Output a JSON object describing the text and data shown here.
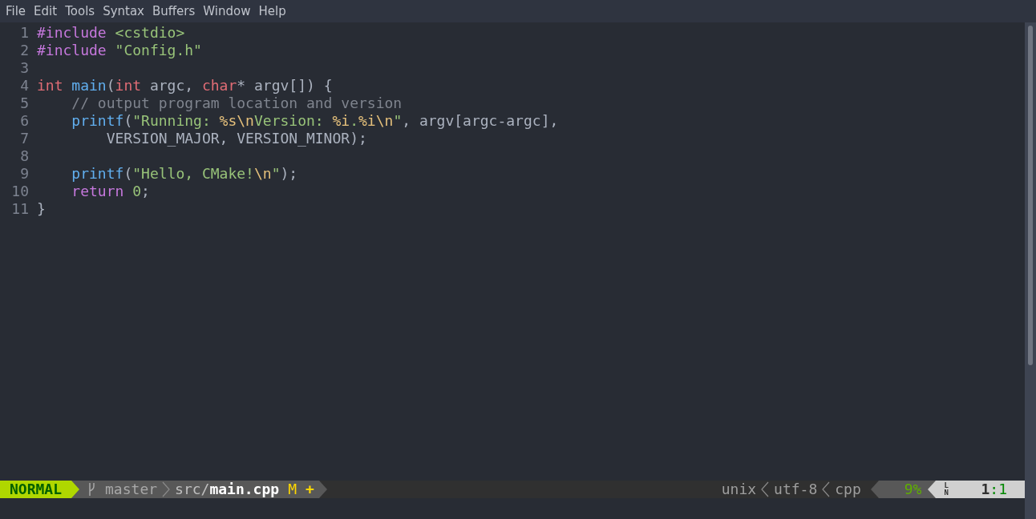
{
  "menu": [
    "File",
    "Edit",
    "Tools",
    "Syntax",
    "Buffers",
    "Window",
    "Help"
  ],
  "lines": [
    {
      "number": "1",
      "tokens": [
        {
          "kind": "preproc",
          "text": "#include "
        },
        {
          "kind": "string",
          "text": "<cstdio>"
        }
      ]
    },
    {
      "number": "2",
      "tokens": [
        {
          "kind": "preproc",
          "text": "#include "
        },
        {
          "kind": "string",
          "text": "\"Config.h\""
        }
      ]
    },
    {
      "number": "3"
    },
    {
      "number": "4",
      "tokens": [
        {
          "kind": "keyword",
          "text": "int "
        },
        {
          "kind": "function",
          "text": "main"
        },
        {
          "kind": "plain",
          "text": "("
        },
        {
          "kind": "keyword",
          "text": "int"
        },
        {
          "kind": "plain",
          "text": " argc, "
        },
        {
          "kind": "keyword",
          "text": "char"
        },
        {
          "kind": "plain",
          "text": "* argv[]) {"
        }
      ]
    },
    {
      "number": "5",
      "tokens": [
        {
          "kind": "comment",
          "text": "    // output program location and version"
        }
      ]
    },
    {
      "number": "6",
      "tokens": [
        {
          "kind": "function",
          "text": "    printf"
        },
        {
          "kind": "plain",
          "text": "("
        },
        {
          "kind": "string",
          "text": "\"Running: "
        },
        {
          "kind": "escape",
          "text": "%s\\n"
        },
        {
          "kind": "string",
          "text": "Version: "
        },
        {
          "kind": "escape",
          "text": "%i"
        },
        {
          "kind": "string",
          "text": "."
        },
        {
          "kind": "escape",
          "text": "%i\\n"
        },
        {
          "kind": "string",
          "text": "\""
        },
        {
          "kind": "plain",
          "text": ", argv[argc-argc],"
        }
      ]
    },
    {
      "number": "7",
      "tokens": [
        {
          "kind": "plain",
          "text": "        VERSION_MAJOR, VERSION_MINOR);"
        }
      ]
    },
    {
      "number": "8"
    },
    {
      "number": "9",
      "tokens": [
        {
          "kind": "function",
          "text": "    printf"
        },
        {
          "kind": "plain",
          "text": "("
        },
        {
          "kind": "string",
          "text": "\"Hello, CMake!"
        },
        {
          "kind": "escape",
          "text": "\\n"
        },
        {
          "kind": "string",
          "text": "\""
        },
        {
          "kind": "plain",
          "text": ");"
        }
      ]
    },
    {
      "number": "10",
      "tokens": [
        {
          "kind": "preproc",
          "text": "    return "
        },
        {
          "kind": "string",
          "text": "0"
        },
        {
          "kind": "plain",
          "text": ";"
        }
      ]
    },
    {
      "number": "11",
      "tokens": [
        {
          "kind": "plain",
          "text": "}"
        }
      ]
    }
  ],
  "status_line": {
    "mode": "NORMAL",
    "branch": "master",
    "file_dir": "src/",
    "file_name": "main.cpp",
    "modified": "M",
    "added": "+",
    "fileformat": "unix",
    "encoding": "utf-8",
    "filetype": "cpp",
    "percent": "9%",
    "line_label": "LN",
    "line": "1",
    "position_separator": ":",
    "column": "1"
  }
}
